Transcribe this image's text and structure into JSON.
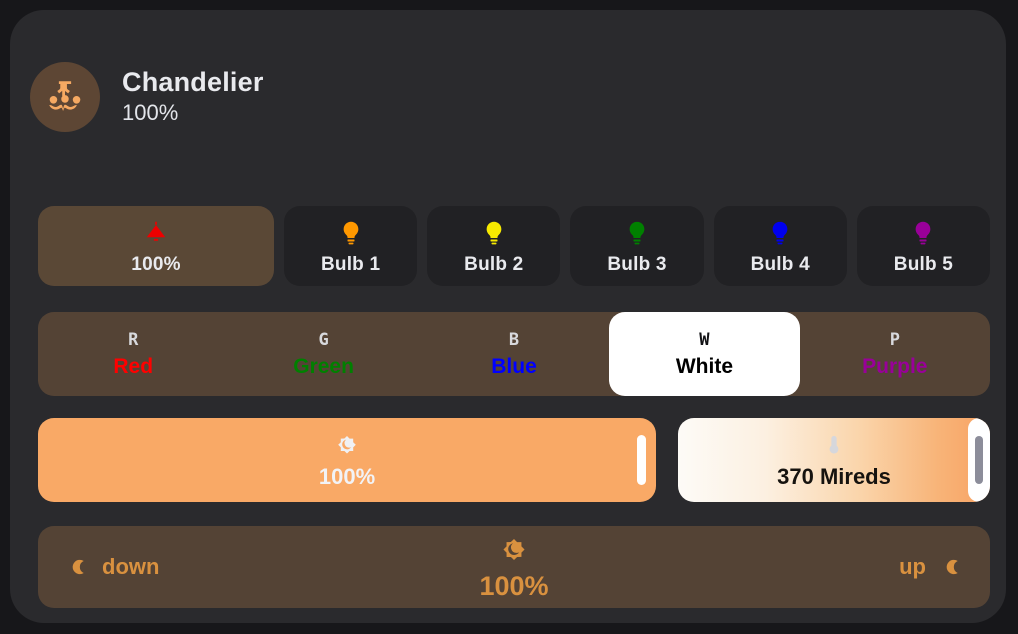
{
  "header": {
    "icon": "chandelier-icon",
    "title": "Chandelier",
    "brightness": "100%",
    "avatar_bg": "#5d4634",
    "icon_color": "#f5a962"
  },
  "bulb_row": {
    "main": {
      "icon": "ceiling-lamp-icon",
      "icon_color": "#ee0000",
      "label": "100%",
      "bg": "#5a4836",
      "active": true
    },
    "bulbs": [
      {
        "icon": "bulb-icon",
        "label": "Bulb 1",
        "color": "#ff9800"
      },
      {
        "icon": "bulb-icon",
        "label": "Bulb 2",
        "color": "#f7ea00"
      },
      {
        "icon": "bulb-icon",
        "label": "Bulb 3",
        "color": "#008000"
      },
      {
        "icon": "bulb-icon",
        "label": "Bulb 4",
        "color": "#0000ee"
      },
      {
        "icon": "bulb-icon",
        "label": "Bulb 5",
        "color": "#990099"
      }
    ]
  },
  "color_row": {
    "bg": "#544335",
    "selected": "White",
    "segments": [
      {
        "key": "R",
        "name": "Red",
        "color": "#ff0000",
        "selected": false
      },
      {
        "key": "G",
        "name": "Green",
        "color": "#008000",
        "selected": false
      },
      {
        "key": "B",
        "name": "Blue",
        "color": "#0000ff",
        "selected": false
      },
      {
        "key": "W",
        "name": "White",
        "color": "#000000",
        "selected": true
      },
      {
        "key": "P",
        "name": "Purple",
        "color": "#990099",
        "selected": false
      }
    ]
  },
  "sliders": {
    "brightness": {
      "icon": "brightness-moon-icon",
      "value": "100%",
      "fill_color": "#f9a966",
      "percent": 100
    },
    "temperature": {
      "icon": "thermometer-icon",
      "value": "370 Mireds",
      "percent": 100
    }
  },
  "dimmer": {
    "bg": "#544335",
    "accent": "#d9913f",
    "left_label": "down",
    "left_icon": "crescent-moon-icon",
    "right_label": "up",
    "right_icon": "crescent-moon-icon",
    "center_icon": "brightness-moon-icon",
    "center_value": "100%"
  }
}
